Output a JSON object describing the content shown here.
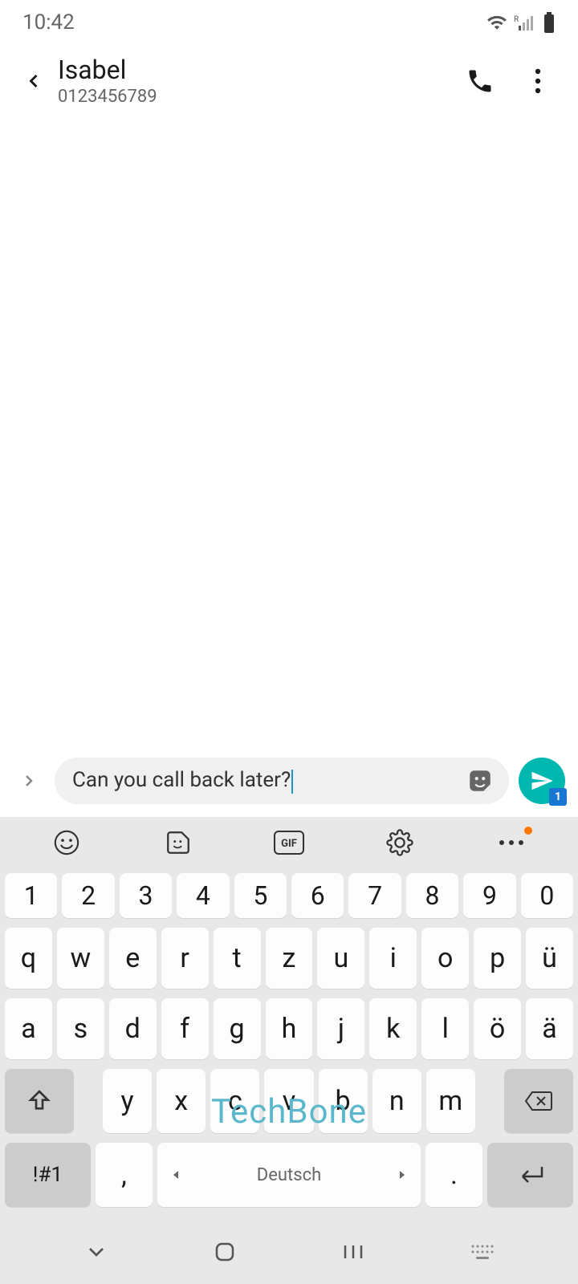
{
  "status": {
    "time": "10:42"
  },
  "header": {
    "contact_name": "Isabel",
    "contact_number": "0123456789"
  },
  "compose": {
    "text": "Can you call back later?",
    "sim_badge": "1"
  },
  "keyboard": {
    "row_numbers": [
      "1",
      "2",
      "3",
      "4",
      "5",
      "6",
      "7",
      "8",
      "9",
      "0"
    ],
    "row1": [
      "q",
      "w",
      "e",
      "r",
      "t",
      "z",
      "u",
      "i",
      "o",
      "p",
      "ü"
    ],
    "row2": [
      "a",
      "s",
      "d",
      "f",
      "g",
      "h",
      "j",
      "k",
      "l",
      "ö",
      "ä"
    ],
    "row3": [
      "y",
      "x",
      "c",
      "v",
      "b",
      "n",
      "m"
    ],
    "sym_key": "!#1",
    "comma_key": ",",
    "space_key": "Deutsch",
    "period_key": "."
  },
  "watermark": "TechBone"
}
